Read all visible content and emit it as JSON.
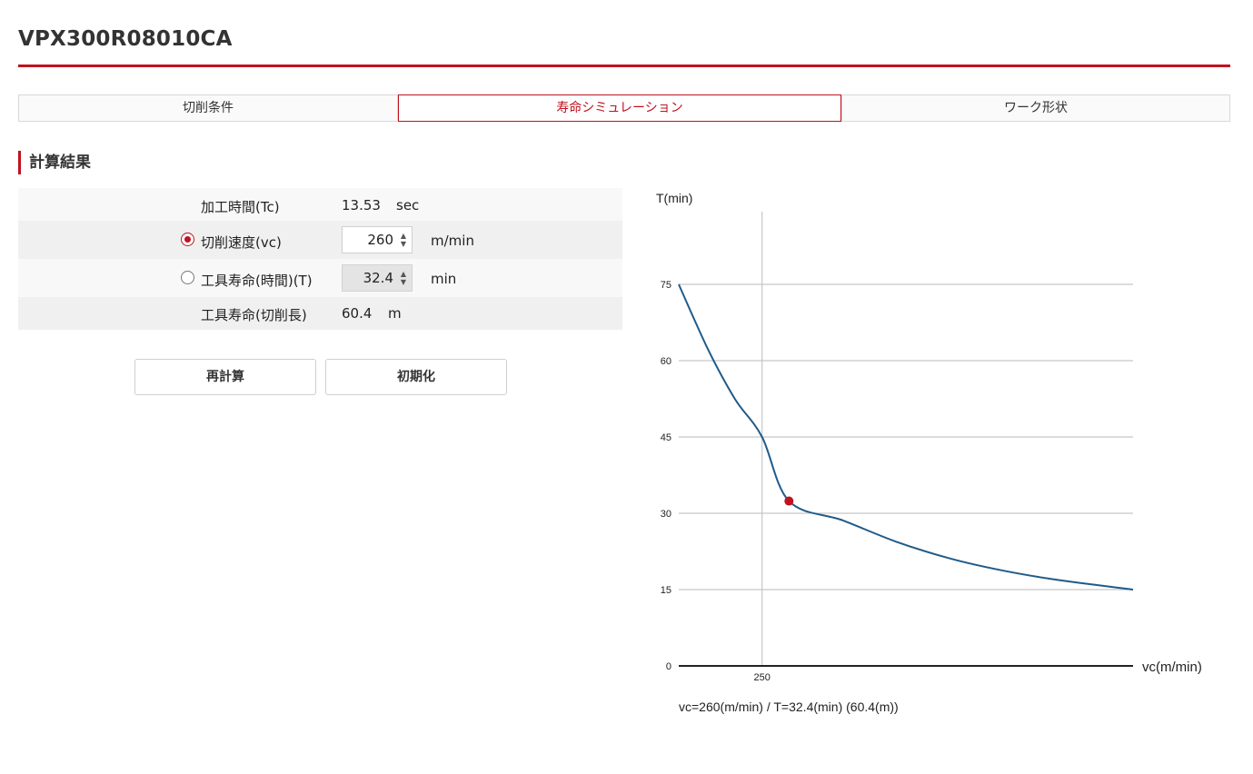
{
  "header": {
    "title": "VPX300R08010CA"
  },
  "tabs": [
    {
      "label": "切削条件",
      "active": false
    },
    {
      "label": "寿命シミュレーション",
      "active": true
    },
    {
      "label": "ワーク形状",
      "active": false
    }
  ],
  "results": {
    "section_title": "計算結果",
    "machining_time": {
      "label": "加工時間(Tc)",
      "value": "13.53",
      "unit": "sec"
    },
    "cutting_speed": {
      "label": "切削速度(vc)",
      "value": "260",
      "unit": "m/min",
      "selected": true
    },
    "tool_life_time": {
      "label": "工具寿命(時間)(T)",
      "value": "32.4",
      "unit": "min",
      "selected": false
    },
    "tool_life_length": {
      "label": "工具寿命(切削長)",
      "value": "60.4",
      "unit": "m"
    }
  },
  "buttons": {
    "recalculate": "再計算",
    "reset": "初期化"
  },
  "colors": {
    "accent": "#c0121f",
    "curve": "#1f5b8a"
  },
  "chart_data": {
    "type": "line",
    "ylabel": "T(min)",
    "xlabel": "vc(m/min)",
    "y_ticks": [
      "0",
      "15",
      "30",
      "45",
      "60",
      "75"
    ],
    "x_ticks": [
      "250"
    ],
    "ylim": [
      0,
      90
    ],
    "xlim": [
      219,
      388
    ],
    "grid": true,
    "series": [
      {
        "values": [
          {
            "x": 219,
            "y": 75.0
          },
          {
            "x": 230,
            "y": 62.1
          },
          {
            "x": 240,
            "y": 52.4
          },
          {
            "x": 250,
            "y": 45.0
          },
          {
            "x": 260,
            "y": 32.4
          },
          {
            "x": 280,
            "y": 28.6
          },
          {
            "x": 300,
            "y": 24.4
          },
          {
            "x": 320,
            "y": 21.1
          },
          {
            "x": 340,
            "y": 18.7
          },
          {
            "x": 360,
            "y": 16.9
          },
          {
            "x": 388,
            "y": 15.0
          }
        ]
      }
    ],
    "marker": {
      "x": 260,
      "y": 32.4
    },
    "footer": "vc=260(m/min) / T=32.4(min) (60.4(m))"
  }
}
